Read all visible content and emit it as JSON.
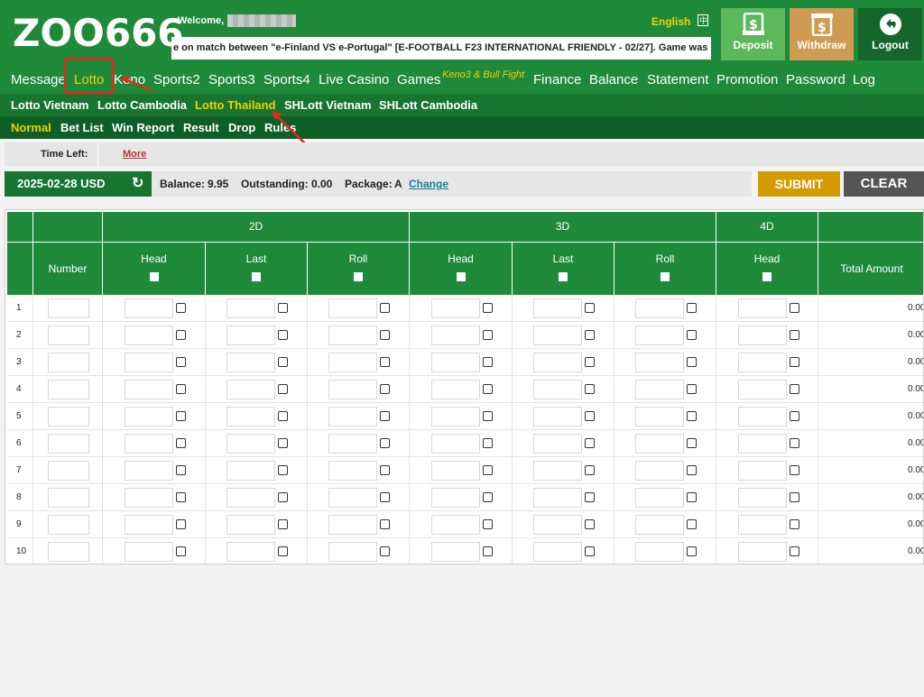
{
  "header": {
    "logo": "ZOO666",
    "welcome": "Welcome,",
    "marquee": "e on match between \"e-Finland VS e-Portugal\" [E-FOOTBALL F23 INTERNATIONAL FRIENDLY - 02/27]. Game was not a",
    "language": "English",
    "buttons": {
      "deposit": "Deposit",
      "withdraw": "Withdraw",
      "logout": "Logout"
    },
    "colors": {
      "primary": "#1e8a3a",
      "deposit": "#5bb85b",
      "withdraw": "#cf9b52",
      "logout": "#15662a",
      "highlight": "#f1d000"
    }
  },
  "nav": {
    "main": [
      {
        "label": "Message",
        "active": false
      },
      {
        "label": "Lotto",
        "active": true
      },
      {
        "label": "Keno",
        "active": false
      },
      {
        "label": "Sports2",
        "active": false
      },
      {
        "label": "Sports3",
        "active": false
      },
      {
        "label": "Sports4",
        "active": false
      },
      {
        "label": "Live Casino",
        "active": false
      },
      {
        "label": "Games",
        "active": false
      },
      {
        "label": "Keno3 & Bull Fight",
        "active": false
      },
      {
        "label": "Finance",
        "active": false
      },
      {
        "label": "Balance",
        "active": false
      },
      {
        "label": "Statement",
        "active": false
      },
      {
        "label": "Promotion",
        "active": false
      },
      {
        "label": "Password",
        "active": false
      },
      {
        "label": "Log",
        "active": false
      }
    ],
    "lotto": [
      {
        "label": "Lotto Vietnam",
        "active": false
      },
      {
        "label": "Lotto Cambodia",
        "active": false
      },
      {
        "label": "Lotto Thailand",
        "active": true
      },
      {
        "label": "SHLott Vietnam",
        "active": false
      },
      {
        "label": "SHLott Cambodia",
        "active": false
      }
    ],
    "sub": [
      {
        "label": "Normal",
        "active": true
      },
      {
        "label": "Bet List",
        "active": false
      },
      {
        "label": "Win Report",
        "active": false
      },
      {
        "label": "Result",
        "active": false
      },
      {
        "label": "Drop",
        "active": false
      },
      {
        "label": "Rules",
        "active": false
      }
    ]
  },
  "timebar": {
    "label": "Time Left:",
    "more": "More"
  },
  "account": {
    "date": "2025-02-28 USD",
    "balance_label": "Balance:",
    "balance": "9.95",
    "outstanding_label": "Outstanding:",
    "outstanding": "0.00",
    "package_label": "Package:",
    "package": "A",
    "change": "Change"
  },
  "actions": {
    "submit": "SUBMIT",
    "clear": "CLEAR"
  },
  "table": {
    "groups": [
      "2D",
      "3D",
      "4D"
    ],
    "number_header": "Number",
    "columns": [
      "Head",
      "Last",
      "Roll",
      "Head",
      "Last",
      "Roll",
      "Head"
    ],
    "total_header": "Total Amount",
    "rows": [
      {
        "n": "1",
        "amount": "0.00"
      },
      {
        "n": "2",
        "amount": "0.00"
      },
      {
        "n": "3",
        "amount": "0.00"
      },
      {
        "n": "4",
        "amount": "0.00"
      },
      {
        "n": "5",
        "amount": "0.00"
      },
      {
        "n": "6",
        "amount": "0.00"
      },
      {
        "n": "7",
        "amount": "0.00"
      },
      {
        "n": "8",
        "amount": "0.00"
      },
      {
        "n": "9",
        "amount": "0.00"
      },
      {
        "n": "10",
        "amount": "0.00"
      }
    ]
  }
}
